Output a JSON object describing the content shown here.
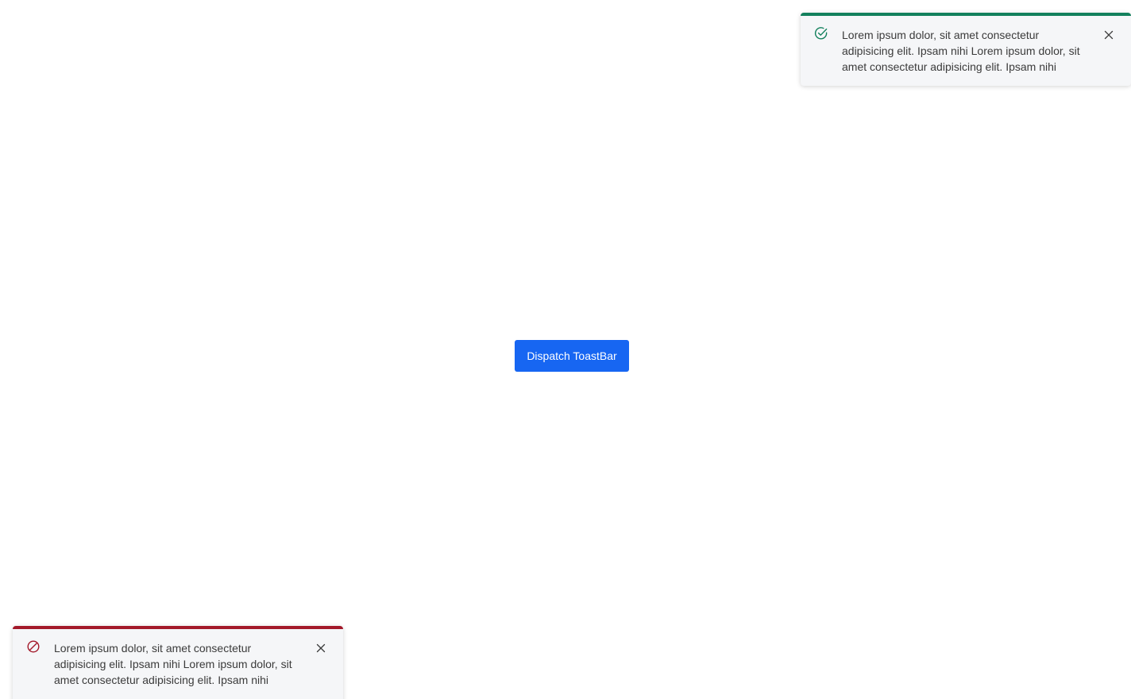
{
  "main": {
    "dispatch_button_label": "Dispatch ToastBar"
  },
  "toasts": {
    "success": {
      "message": "Lorem ipsum dolor, sit amet consectetur adipisicing elit. Ipsam nihi Lorem ipsum dolor, sit amet consectetur adipisicing elit. Ipsam nihi",
      "status_icon": "check-circle-icon",
      "close_icon": "close-icon",
      "accent_color": "#12805c"
    },
    "error": {
      "message": "Lorem ipsum dolor, sit amet consectetur adipisicing elit. Ipsam nihi Lorem ipsum dolor, sit amet consectetur adipisicing elit. Ipsam nihi",
      "status_icon": "prohibited-icon",
      "close_icon": "close-icon",
      "accent_color": "#a3192a"
    }
  },
  "colors": {
    "primary_button": "#1766f2",
    "toast_background": "#f5f6f8"
  }
}
